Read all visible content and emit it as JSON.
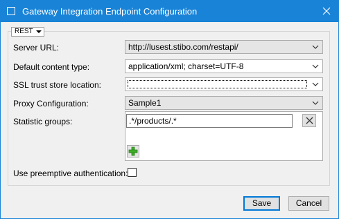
{
  "window": {
    "title": "Gateway Integration Endpoint Configuration",
    "accent_color": "#1883d7"
  },
  "protocol": {
    "selected": "REST"
  },
  "form": {
    "server_url": {
      "label": "Server URL:",
      "value": "http://lusest.stibo.com/restapi/"
    },
    "default_content_type": {
      "label": "Default content type:",
      "value": "application/xml; charset=UTF-8"
    },
    "ssl_trust_store_location": {
      "label": "SSL trust store location:",
      "value": ""
    },
    "proxy_configuration": {
      "label": "Proxy Configuration:",
      "value": "Sample1"
    },
    "statistic_groups": {
      "label": "Statistic groups:",
      "entries": [
        ".*/products/.*"
      ]
    },
    "use_preemptive_authentication": {
      "label": "Use preemptive authentication:",
      "checked": false
    }
  },
  "buttons": {
    "save": "Save",
    "cancel": "Cancel"
  },
  "icons": {
    "window": "window-icon",
    "close": "close-icon",
    "dropdown": "chevron-down-icon",
    "remove": "remove-icon",
    "add": "add-icon"
  }
}
